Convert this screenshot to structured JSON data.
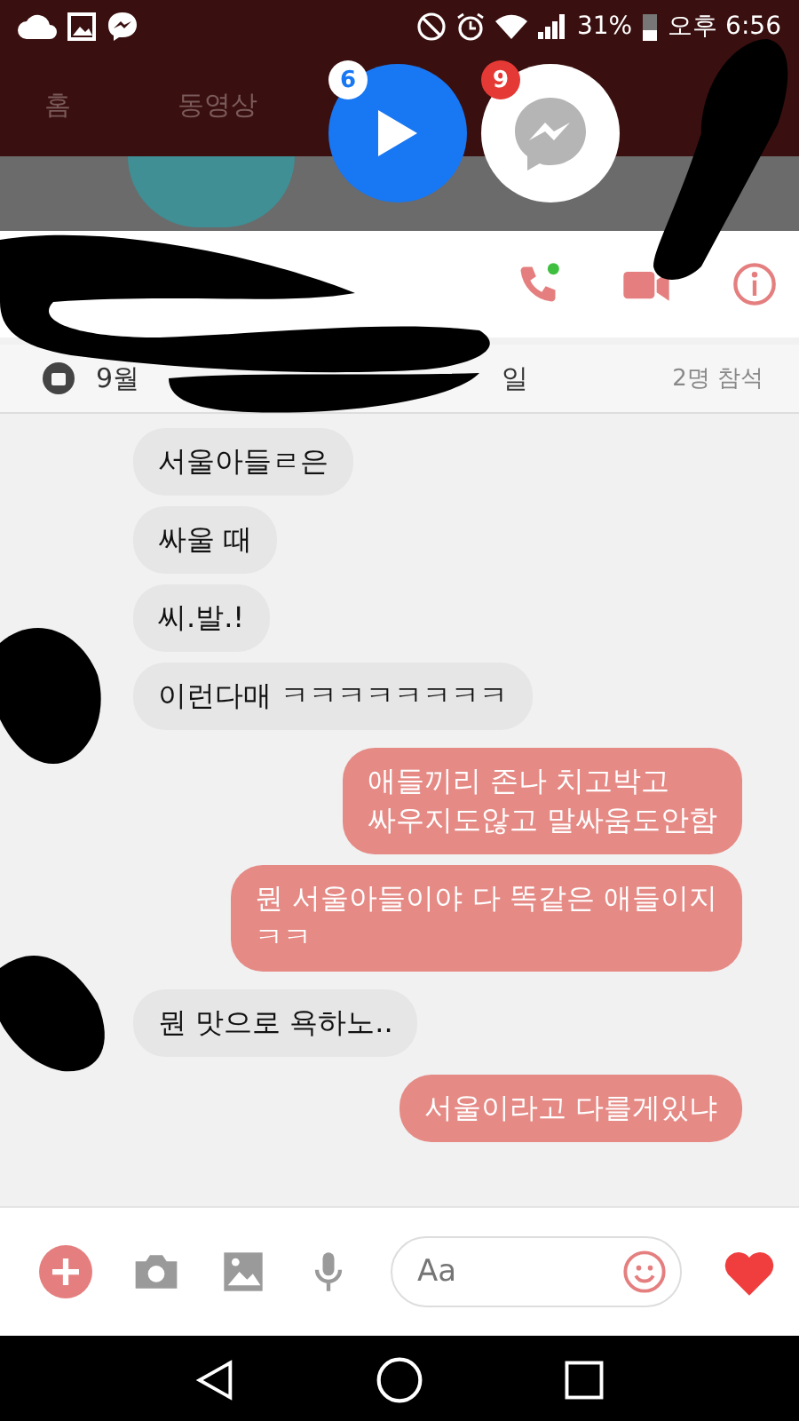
{
  "status_bar": {
    "battery": "31%",
    "time": "오후 6:56"
  },
  "background_tabs": [
    {
      "label": "홈"
    },
    {
      "label": "동영상"
    }
  ],
  "chat_heads": [
    {
      "kind": "video",
      "badge": "6"
    },
    {
      "kind": "messenger",
      "badge": "9"
    }
  ],
  "event_bar": {
    "date_start": "9월",
    "date_end": "일",
    "attendees": "2명 참석"
  },
  "messages": [
    {
      "kind": "received",
      "text": "서울아들ㄹ은"
    },
    {
      "kind": "received",
      "text": "싸울 때"
    },
    {
      "kind": "received",
      "text": "씨.발.!"
    },
    {
      "kind": "received",
      "text": "이런다매 ㅋㅋㅋㅋㅋㅋㅋㅋ"
    },
    {
      "kind": "sent",
      "text": "애들끼리 존나 치고박고\n싸우지도않고 말싸움도안함"
    },
    {
      "kind": "sent",
      "text": "뭔 서울아들이야 다 똑같은 애들이지\nㅋㅋ"
    },
    {
      "kind": "received",
      "text": "뭔 맛으로 욕하노.."
    },
    {
      "kind": "sent",
      "text": "서울이라고 다를게있냐"
    }
  ],
  "composer": {
    "placeholder": "Aa"
  }
}
